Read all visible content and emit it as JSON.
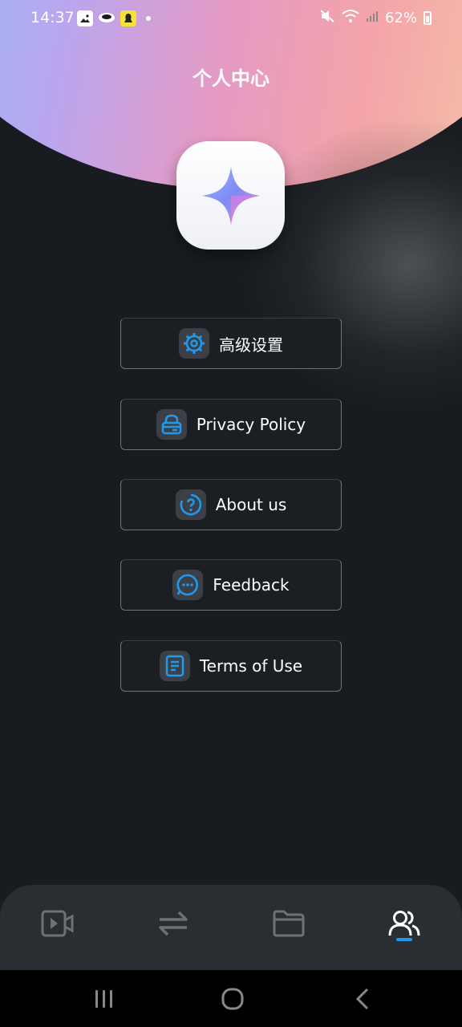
{
  "status_bar": {
    "time": "14:37",
    "battery": "62%"
  },
  "header": {
    "title": "个人中心"
  },
  "app_icon": "sparkle-star-icon",
  "menu": {
    "items": [
      {
        "label": "高级设置",
        "icon": "gear-icon"
      },
      {
        "label": "Privacy Policy",
        "icon": "lock-icon"
      },
      {
        "label": "About us",
        "icon": "help-circle-icon"
      },
      {
        "label": "Feedback",
        "icon": "chat-bubble-icon"
      },
      {
        "label": "Terms of Use",
        "icon": "document-icon"
      }
    ]
  },
  "bottom_nav": {
    "items": [
      {
        "icon": "video-icon",
        "active": false
      },
      {
        "icon": "swap-arrows-icon",
        "active": false
      },
      {
        "icon": "folder-icon",
        "active": false
      },
      {
        "icon": "users-icon",
        "active": true
      }
    ]
  },
  "colors": {
    "accent": "#1e9bf0",
    "background": "#181b1f",
    "nav_background": "#2a2d31"
  }
}
